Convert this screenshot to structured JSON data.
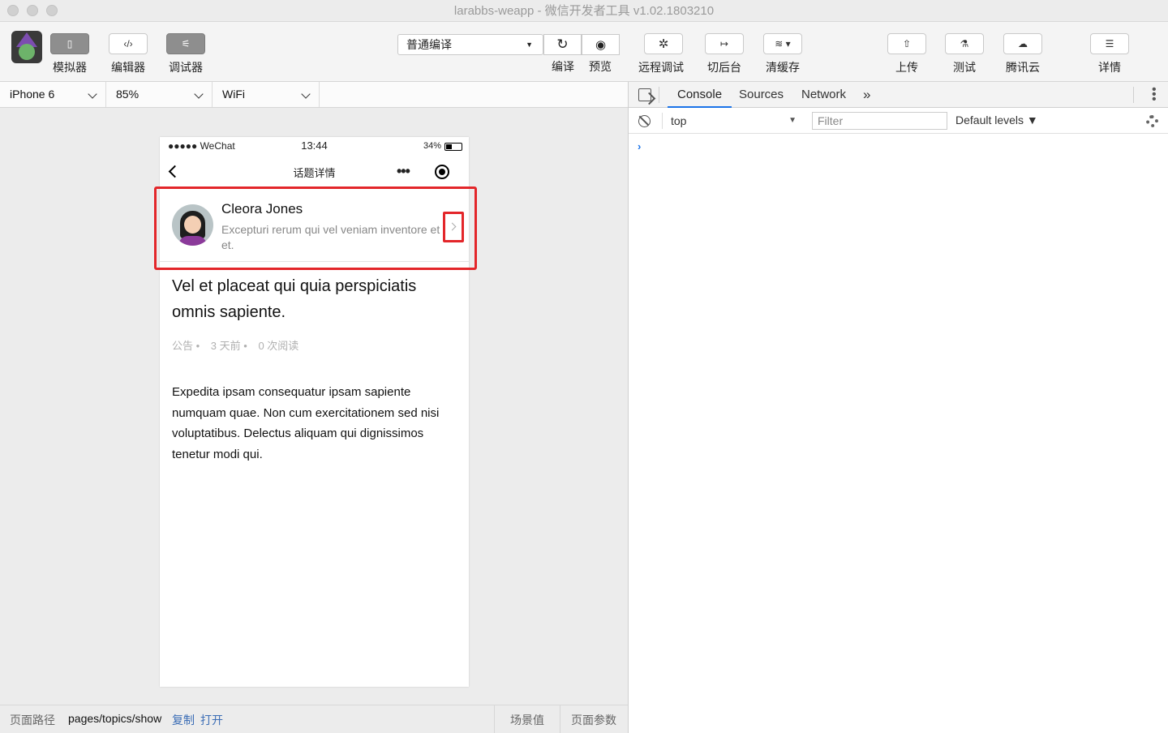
{
  "window": {
    "title": "larabbs-weapp - 微信开发者工具 v1.02.1803210"
  },
  "toolbar": {
    "simulator": "模拟器",
    "editor": "编辑器",
    "debugger": "调试器",
    "compile_mode": "普通编译",
    "compile": "编译",
    "preview": "预览",
    "remote_debug": "远程调试",
    "background": "切后台",
    "clear_cache": "清缓存",
    "upload": "上传",
    "test": "测试",
    "tencent_cloud": "腾讯云",
    "details": "详情"
  },
  "device_bar": {
    "device": "iPhone 6",
    "zoom": "85%",
    "network": "WiFi"
  },
  "phone": {
    "status": {
      "carrier": "●●●●● WeChat",
      "time": "13:44",
      "battery": "34%"
    },
    "nav_title": "话题详情",
    "author": {
      "name": "Cleora Jones",
      "intro": "Excepturi rerum qui vel veniam inventore et et."
    },
    "topic": {
      "title": "Vel et placeat qui quia perspiciatis omnis sapiente.",
      "category": "公告 •",
      "time": "3 天前 •",
      "views": "0 次阅读",
      "body": "Expedita ipsam consequatur ipsam sapiente numquam quae. Non cum exercitationem sed nisi voluptatibus. Delectus aliquam qui dignissimos tenetur modi qui."
    },
    "highlight_color": "#e3262a"
  },
  "bottom_bar": {
    "path_label": "页面路径",
    "path": "pages/topics/show",
    "copy": "复制",
    "open": "打开",
    "scene": "场景值",
    "params": "页面参数"
  },
  "devtools": {
    "tabs": [
      "Console",
      "Sources",
      "Network"
    ],
    "more_tabs": "»",
    "context": "top",
    "filter_placeholder": "Filter",
    "levels": "Default levels ▼",
    "prompt": "›",
    "accent": "#1a73e8"
  }
}
